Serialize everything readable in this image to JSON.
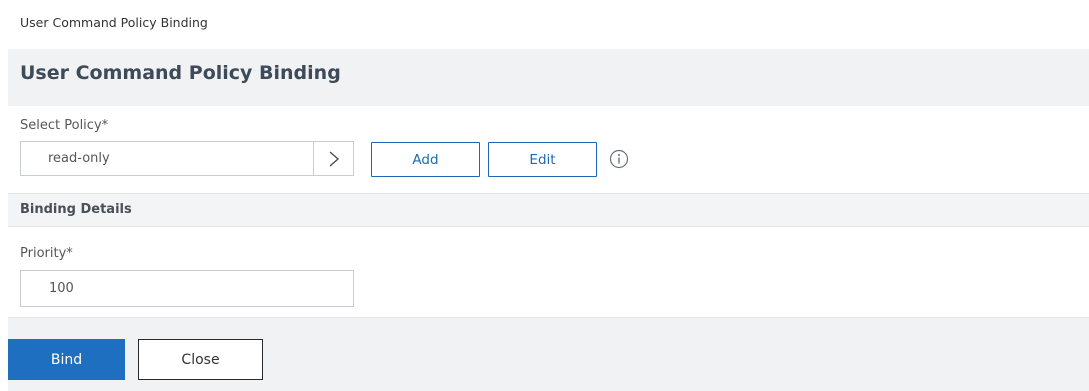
{
  "breadcrumb": "User Command Policy Binding",
  "page_title": "User Command Policy Binding",
  "select_policy": {
    "label": "Select Policy*",
    "value": "read-only",
    "chevron_icon": "chevron-right-icon",
    "add_label": "Add",
    "edit_label": "Edit",
    "info_icon": "info-icon"
  },
  "binding_details": {
    "section_title": "Binding Details",
    "priority_label": "Priority*",
    "priority_value": "100"
  },
  "footer": {
    "bind_label": "Bind",
    "close_label": "Close"
  },
  "colors": {
    "accent": "#1e6fc0",
    "header_bg": "#f1f2f4",
    "title_text": "#3d4a58"
  }
}
